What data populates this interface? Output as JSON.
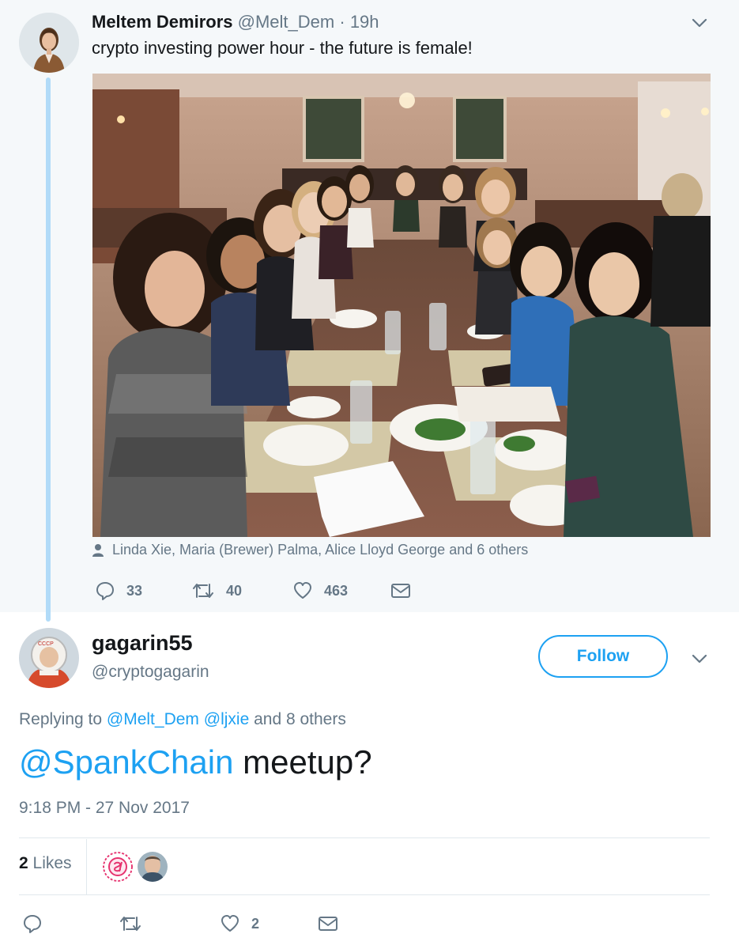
{
  "parent_tweet": {
    "author_name": "Meltem Demirors",
    "author_handle": "@Melt_Dem",
    "separator": "·",
    "time_ago": "19h",
    "text": "crypto investing power hour - the future is female!",
    "tagged_people": "Linda Xie, Maria (Brewer) Palma, Alice Lloyd George and 6 others",
    "actions": {
      "reply_count": "33",
      "retweet_count": "40",
      "like_count": "463"
    }
  },
  "reply_tweet": {
    "author_name": "gagarin55",
    "author_handle": "@cryptogagarin",
    "follow_label": "Follow",
    "replying_prefix": "Replying to ",
    "replying_mention_1": "@Melt_Dem",
    "replying_mention_2": "@ljxie",
    "replying_suffix": " and 8 others",
    "mention": "@SpankChain",
    "text": " meetup?",
    "timestamp": "9:18 PM - 27 Nov 2017",
    "likes_count": "2",
    "likes_label": " Likes",
    "actions": {
      "like_count": "2"
    }
  },
  "colors": {
    "accent": "#1da1f2",
    "secondary_text": "#657786",
    "thread_line": "#b1dbf8",
    "parent_background": "#f5f8fa"
  },
  "icons": [
    "chevron-down-icon",
    "person-icon",
    "reply-icon",
    "retweet-icon",
    "like-icon",
    "message-icon"
  ]
}
